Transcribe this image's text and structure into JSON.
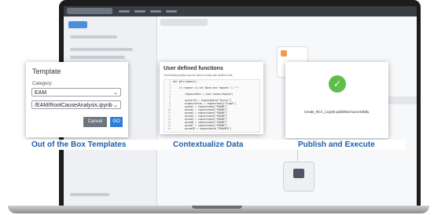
{
  "template_dialog": {
    "title": "Template",
    "category_label": "Category:",
    "category_value": "EAM",
    "template_value": "/EAM/RootCauseAnalysis.ipynb",
    "cancel_label": "Cancel",
    "go_label": "GO"
  },
  "udf_panel": {
    "title": "User defined functions",
    "subtitle": "The following section can be used to create user defined code.",
    "code_lines": [
      "def get(request):",
      "",
      "    if request is not None and request != \"\":",
      "",
      "        requestdata = json.loads(request)",
      "",
      "        sectorId = requestdata[\"Sector\"]",
      "        organization = requestdata[\"Scope\"]",
      "        param1 = requestdata[\"PARAM\"]",
      "        param2 = requestdata[\"PARAM\"]",
      "        param3 = requestdata[\"PARAM\"]",
      "        param4 = requestdata[\"PARAM\"]",
      "        param5 = requestdata[\"PARAM\"]",
      "        param6 = requestdata[\"PARAM\"]",
      "        param7 = requestdata[\"PARAM\"]",
      "        paramID = requestdata[\"PARAMID\"]"
    ]
  },
  "publish_panel": {
    "message": "Create_RCA_1.ipynb published successfully."
  },
  "captions": {
    "left": "Out of the Box Templates",
    "center": "Contextualize Data",
    "right": "Publish and Execute"
  },
  "colors": {
    "caption_blue": "#1f5fa8",
    "go_blue": "#2e7fd6",
    "success_green": "#5fbd4c",
    "cancel_gray": "#6f757d"
  },
  "icons": {
    "success": "check-circle-icon",
    "select_chevron": "chevron-down-icon"
  }
}
